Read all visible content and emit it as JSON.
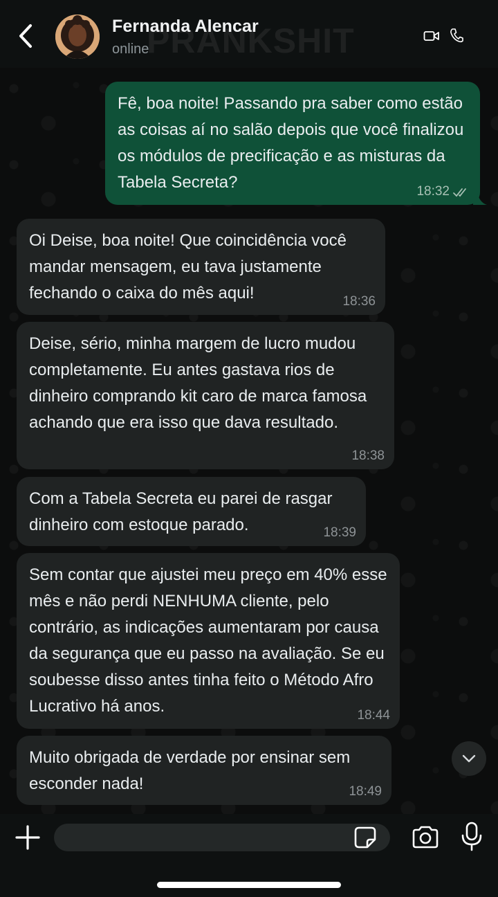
{
  "header": {
    "contact_name": "Fernanda Alencar",
    "contact_status": "online"
  },
  "watermark": "PRANKSHIT",
  "messages": [
    {
      "direction": "outgoing",
      "text": "Fê, boa noite! Passando pra saber como estão as coisas aí no salão depois que você finalizou os módulos de precificação e as misturas da Tabela Secreta?",
      "time": "18:32",
      "status": "read"
    },
    {
      "direction": "incoming",
      "text": "Oi Deise, boa noite! Que coincidência você mandar mensagem, eu tava justamente fechando o caixa do mês aqui!",
      "time": "18:36"
    },
    {
      "direction": "incoming",
      "text": "Deise, sério, minha margem de lucro mudou completamente. Eu antes gastava rios de dinheiro comprando kit caro de marca famosa achando que era isso que dava resultado.",
      "time": "18:38"
    },
    {
      "direction": "incoming",
      "text": "Com a Tabela Secreta eu parei de rasgar dinheiro com estoque parado.",
      "time": "18:39"
    },
    {
      "direction": "incoming",
      "text": "Sem contar que ajustei meu preço em 40% esse mês e não perdi NENHUMA cliente, pelo contrário, as indicações aumentaram por causa da segurança que eu passo na avaliação. Se eu soubesse disso antes tinha feito o Método Afro Lucrativo há anos.",
      "time": "18:44"
    },
    {
      "direction": "incoming",
      "text": "Muito obrigada de verdade por ensinar sem esconder nada!",
      "time": "18:49"
    }
  ],
  "composer": {
    "placeholder": "",
    "value": ""
  },
  "icons": {
    "back": "chevron-left-icon",
    "video": "video-camera-icon",
    "call": "phone-icon",
    "scroll": "chevron-down-icon",
    "plus": "plus-icon",
    "sticker": "sticker-icon",
    "camera": "camera-icon",
    "mic": "microphone-icon"
  },
  "colors": {
    "outgoing_bubble": "#0f5138",
    "incoming_bubble": "#202323",
    "background": "#0b0d0c"
  }
}
